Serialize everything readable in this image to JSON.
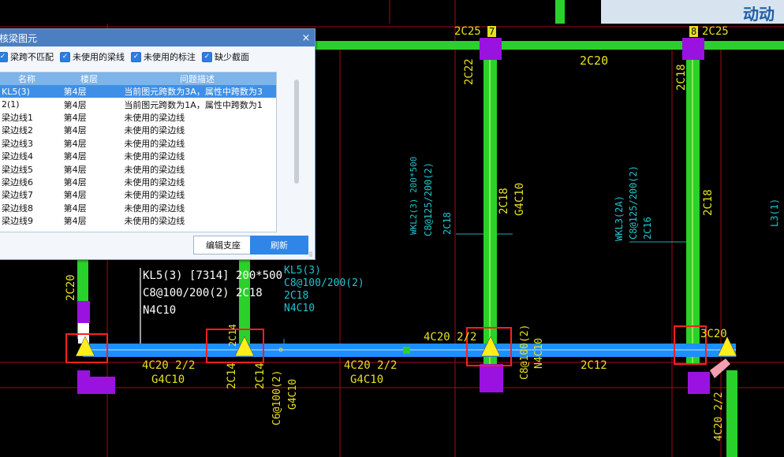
{
  "corner_text": "动动",
  "dialog": {
    "title": "核梁图元",
    "close": "×",
    "filters": [
      {
        "label": "梁跨不匹配",
        "checked": true
      },
      {
        "label": "未使用的梁线",
        "checked": true
      },
      {
        "label": "未使用的标注",
        "checked": true
      },
      {
        "label": "缺少截面",
        "checked": true
      }
    ],
    "columns": [
      "名称",
      "楼层",
      "问题描述"
    ],
    "rows": [
      {
        "name": "KL5(3)",
        "floor": "第4层",
        "desc": "当前图元跨数为3A，属性中跨数为3",
        "selected": true
      },
      {
        "name": "2(1)",
        "floor": "第4层",
        "desc": "当前图元跨数为1A，属性中跨数为1"
      },
      {
        "name": "梁边线1",
        "floor": "第4层",
        "desc": "未使用的梁边线"
      },
      {
        "name": "梁边线2",
        "floor": "第4层",
        "desc": "未使用的梁边线"
      },
      {
        "name": "梁边线3",
        "floor": "第4层",
        "desc": "未使用的梁边线"
      },
      {
        "name": "梁边线4",
        "floor": "第4层",
        "desc": "未使用的梁边线"
      },
      {
        "name": "梁边线5",
        "floor": "第4层",
        "desc": "未使用的梁边线"
      },
      {
        "name": "梁边线6",
        "floor": "第4层",
        "desc": "未使用的梁边线"
      },
      {
        "name": "梁边线7",
        "floor": "第4层",
        "desc": "未使用的梁边线"
      },
      {
        "name": "梁边线8",
        "floor": "第4层",
        "desc": "未使用的梁边线"
      },
      {
        "name": "梁边线9",
        "floor": "第4层",
        "desc": "未使用的梁边线"
      }
    ],
    "edit_button": "编辑支座",
    "refresh_button": "刷新"
  },
  "cad": {
    "grid_labels": [
      "7",
      "8"
    ],
    "beam_annotation": [
      "KL5(3) [7314] 200*500",
      "C8@100/200(2) 2C18",
      "N4C10"
    ],
    "kl5_note": [
      "KL5(3)",
      "C8@100/200(2)",
      "2C18",
      "N4C10"
    ],
    "top_labels": [
      "2C25",
      "2C25",
      "2C20"
    ],
    "col_labels": [
      "2C22",
      "2C18",
      "2C18",
      "G4C10",
      "2C18",
      "2C20"
    ],
    "wkl2": [
      "WKL2(3) 200*500",
      "C8@125/200(2)",
      "2C18"
    ],
    "wkl3": [
      "WKL3(2A)",
      "C8@125/200(2)",
      "2C16"
    ],
    "l3": "L3(1)",
    "lower_labels": [
      "4C20 2/2",
      "G4C10",
      "2C14",
      "2C14",
      "4C20 2/2",
      "G4C10",
      "C6@100(2)",
      "G4C10",
      "4C20 2/2",
      "C8@100(2)",
      "N4C10",
      "2C12",
      "3C20",
      "4C20 2/2",
      "2C14"
    ],
    "colors": {
      "beam_green": "#2ad12a",
      "beam_blue": "#1e8fff",
      "column_purple": "#9a12e0",
      "annotation_yellow": "#e8e020",
      "annotation_cyan": "#21c4cf",
      "grid_red": "#a30a14",
      "marker_red": "#ff2020"
    }
  }
}
